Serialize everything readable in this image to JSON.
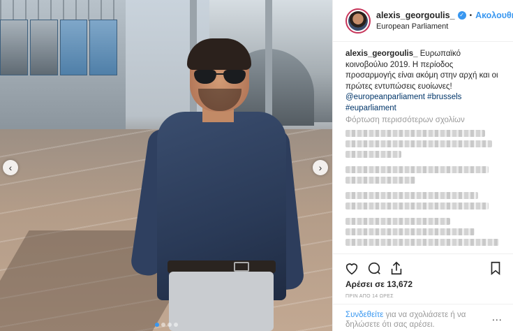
{
  "post": {
    "username": "alexis_georgoulis_",
    "follow_label": "Ακολουθήστε",
    "location": "European Parliament",
    "caption_user": "alexis_georgoulis_",
    "caption_text": " Ευρωπαϊκό κοινοβούλιο 2019. Η περίοδος προσαρμογής είναι ακόμη στην αρχή και οι πρώτες εντυπώσεις ευοίωνες!",
    "mention": "@europeanparliament",
    "hashtag_1": "#brussels",
    "hashtag_2": "#euparliament",
    "load_more": "Φόρτωση περισσότερων σχολίων",
    "likes": "Αρέσει σε 13,672",
    "time": "ΠΡΙΝ ΑΠΟ 14 ΩΡΕΣ",
    "login_link": "Συνδεθείτε",
    "login_text": " για να σχολιάσετε ή να δηλώσετε ότι σας αρέσει.",
    "more_icon": "..."
  },
  "carousel": {
    "prev": "‹",
    "next": "›",
    "slides": 4,
    "active_slide": 1
  },
  "colors": {
    "link": "#3897f0",
    "tag": "#003569",
    "muted": "#999999",
    "avatar_ring": "#c7355a"
  },
  "icons": [
    "heart-icon",
    "comment-icon",
    "share-icon",
    "bookmark-icon",
    "verified-icon"
  ]
}
